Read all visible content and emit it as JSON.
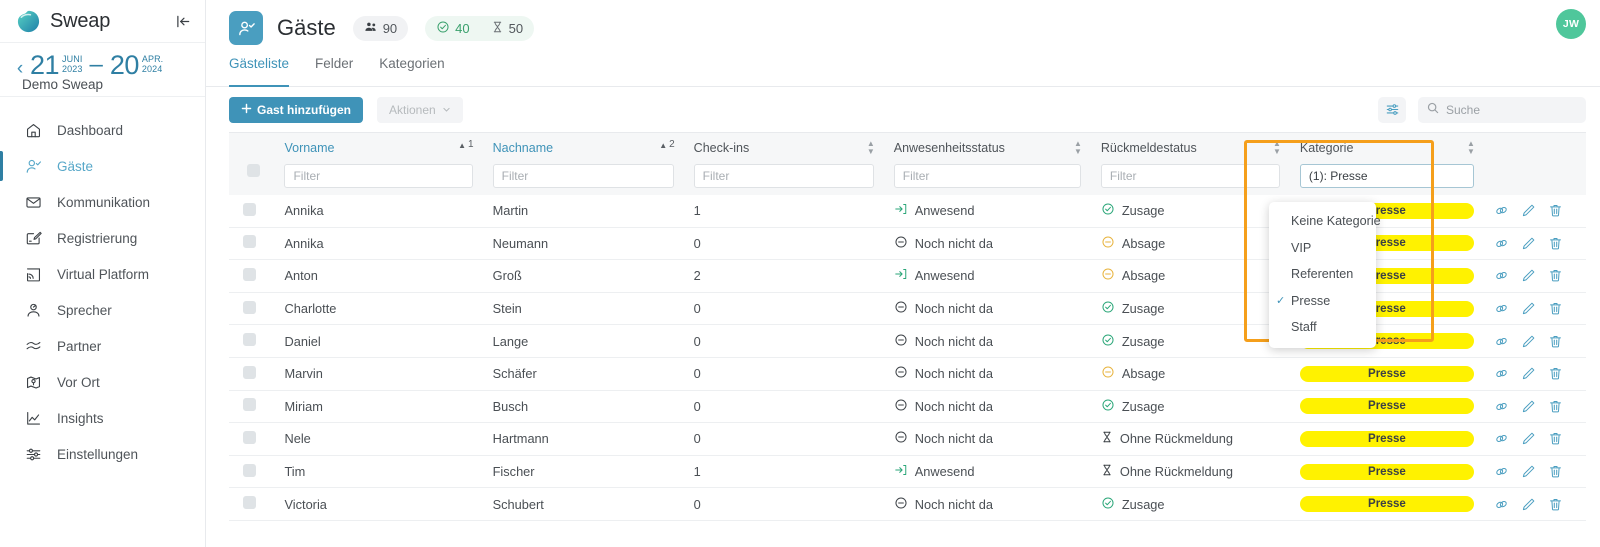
{
  "sidebar": {
    "brand": {
      "name": "Sweap",
      "logo_icon": "sweap-logo",
      "collapse_icon": "collapse-sidebar-icon"
    },
    "event": {
      "back_icon": "chevron-left-icon",
      "start_day": "21",
      "start_month": "JUNI",
      "start_year": "2023",
      "dash": "–",
      "end_day": "20",
      "end_month": "APR.",
      "end_year": "2024",
      "name": "Demo Sweap"
    },
    "items": [
      {
        "label": "Dashboard",
        "icon": "home-icon",
        "active": false
      },
      {
        "label": "Gäste",
        "icon": "user-check-icon",
        "active": true
      },
      {
        "label": "Kommunikation",
        "icon": "envelope-icon",
        "active": false
      },
      {
        "label": "Registrierung",
        "icon": "form-edit-icon",
        "active": false
      },
      {
        "label": "Virtual Platform",
        "icon": "broadcast-icon",
        "active": false
      },
      {
        "label": "Sprecher",
        "icon": "speaker-icon",
        "active": false
      },
      {
        "label": "Partner",
        "icon": "handshake-icon",
        "active": false
      },
      {
        "label": "Vor Ort",
        "icon": "map-pin-icon",
        "active": false
      },
      {
        "label": "Insights",
        "icon": "chart-line-icon",
        "active": false
      },
      {
        "label": "Einstellungen",
        "icon": "sliders-icon",
        "active": false
      }
    ]
  },
  "header": {
    "page_icon": "guests-icon",
    "title": "Gäste",
    "chip_total_icon": "people-icon",
    "chip_total": "90",
    "chip_confirmed_icon": "check-circle-icon",
    "chip_confirmed": "40",
    "chip_pending_icon": "hourglass-icon",
    "chip_pending": "50",
    "avatar_initials": "JW",
    "avatar_color": "#4fc79b"
  },
  "tabs": [
    {
      "label": "Gästeliste",
      "active": true
    },
    {
      "label": "Felder",
      "active": false
    },
    {
      "label": "Kategorien",
      "active": false
    }
  ],
  "toolbar": {
    "add_guest_label": "Gast hinzufügen",
    "add_icon": "plus-icon",
    "actions_label": "Aktionen",
    "actions_caret": "chevron-down-icon",
    "filter_icon": "filter-sliders-icon",
    "search_icon": "search-icon",
    "search_placeholder": "Suche",
    "search_value": ""
  },
  "table": {
    "columns": [
      {
        "label": "Vorname",
        "sortable": true,
        "sort_dir": "asc",
        "sort_order": "1"
      },
      {
        "label": "Nachname",
        "sortable": true,
        "sort_dir": "asc",
        "sort_order": "2"
      },
      {
        "label": "Check-ins",
        "sortable": true,
        "sort_dir": "none",
        "sort_order": ""
      },
      {
        "label": "Anwesenheitsstatus",
        "sortable": true,
        "sort_dir": "none",
        "sort_order": ""
      },
      {
        "label": "Rückmeldestatus",
        "sortable": true,
        "sort_dir": "none",
        "sort_order": ""
      },
      {
        "label": "Kategorie",
        "sortable": true,
        "sort_dir": "none",
        "sort_order": ""
      }
    ],
    "filter_placeholder": "Filter",
    "filters": {
      "vorname": "",
      "nachname": "",
      "checkins": "",
      "anwesenheit": "",
      "rueckmeldung": "",
      "kategorie_value": "(1): Presse"
    },
    "rows": [
      {
        "vorname": "Annika",
        "nachname": "Martin",
        "checkins": "1",
        "anwesenheit": "Anwesend",
        "anwesenheit_icon": "arrow-enter-icon",
        "rueckmeldung": "Zusage",
        "rueckmeldung_icon": "check-circle-icon",
        "kategorie": "Presse"
      },
      {
        "vorname": "Annika",
        "nachname": "Neumann",
        "checkins": "0",
        "anwesenheit": "Noch nicht da",
        "anwesenheit_icon": "minus-circle-icon",
        "rueckmeldung": "Absage",
        "rueckmeldung_icon": "minus-circle-icon",
        "kategorie": "Presse"
      },
      {
        "vorname": "Anton",
        "nachname": "Groß",
        "checkins": "2",
        "anwesenheit": "Anwesend",
        "anwesenheit_icon": "arrow-enter-icon",
        "rueckmeldung": "Absage",
        "rueckmeldung_icon": "minus-circle-icon",
        "kategorie": "Presse"
      },
      {
        "vorname": "Charlotte",
        "nachname": "Stein",
        "checkins": "0",
        "anwesenheit": "Noch nicht da",
        "anwesenheit_icon": "minus-circle-icon",
        "rueckmeldung": "Zusage",
        "rueckmeldung_icon": "check-circle-icon",
        "kategorie": "Presse"
      },
      {
        "vorname": "Daniel",
        "nachname": "Lange",
        "checkins": "0",
        "anwesenheit": "Noch nicht da",
        "anwesenheit_icon": "minus-circle-icon",
        "rueckmeldung": "Zusage",
        "rueckmeldung_icon": "check-circle-icon",
        "kategorie": "Presse"
      },
      {
        "vorname": "Marvin",
        "nachname": "Schäfer",
        "checkins": "0",
        "anwesenheit": "Noch nicht da",
        "anwesenheit_icon": "minus-circle-icon",
        "rueckmeldung": "Absage",
        "rueckmeldung_icon": "minus-circle-icon",
        "kategorie": "Presse"
      },
      {
        "vorname": "Miriam",
        "nachname": "Busch",
        "checkins": "0",
        "anwesenheit": "Noch nicht da",
        "anwesenheit_icon": "minus-circle-icon",
        "rueckmeldung": "Zusage",
        "rueckmeldung_icon": "check-circle-icon",
        "kategorie": "Presse"
      },
      {
        "vorname": "Nele",
        "nachname": "Hartmann",
        "checkins": "0",
        "anwesenheit": "Noch nicht da",
        "anwesenheit_icon": "minus-circle-icon",
        "rueckmeldung": "Ohne Rückmeldung",
        "rueckmeldung_icon": "hourglass-icon",
        "kategorie": "Presse"
      },
      {
        "vorname": "Tim",
        "nachname": "Fischer",
        "checkins": "1",
        "anwesenheit": "Anwesend",
        "anwesenheit_icon": "arrow-enter-icon",
        "rueckmeldung": "Ohne Rückmeldung",
        "rueckmeldung_icon": "hourglass-icon",
        "kategorie": "Presse"
      },
      {
        "vorname": "Victoria",
        "nachname": "Schubert",
        "checkins": "0",
        "anwesenheit": "Noch nicht da",
        "anwesenheit_icon": "minus-circle-icon",
        "rueckmeldung": "Zusage",
        "rueckmeldung_icon": "check-circle-icon",
        "kategorie": "Presse"
      }
    ],
    "row_actions": [
      {
        "icon": "link-icon"
      },
      {
        "icon": "pencil-icon"
      },
      {
        "icon": "trash-icon"
      }
    ]
  },
  "category_dropdown": {
    "open": true,
    "options": [
      {
        "label": "Keine Kategorie",
        "selected": false
      },
      {
        "label": "VIP",
        "selected": false
      },
      {
        "label": "Referenten",
        "selected": false
      },
      {
        "label": "Presse",
        "selected": true
      },
      {
        "label": "Staff",
        "selected": false
      }
    ],
    "check_icon": "check-icon"
  },
  "colors": {
    "accent": "#3f93b8",
    "category_badge": "#fff200",
    "highlight": "#f59f1b",
    "status_green": "#39a06c",
    "status_amber": "#e8b33c"
  }
}
